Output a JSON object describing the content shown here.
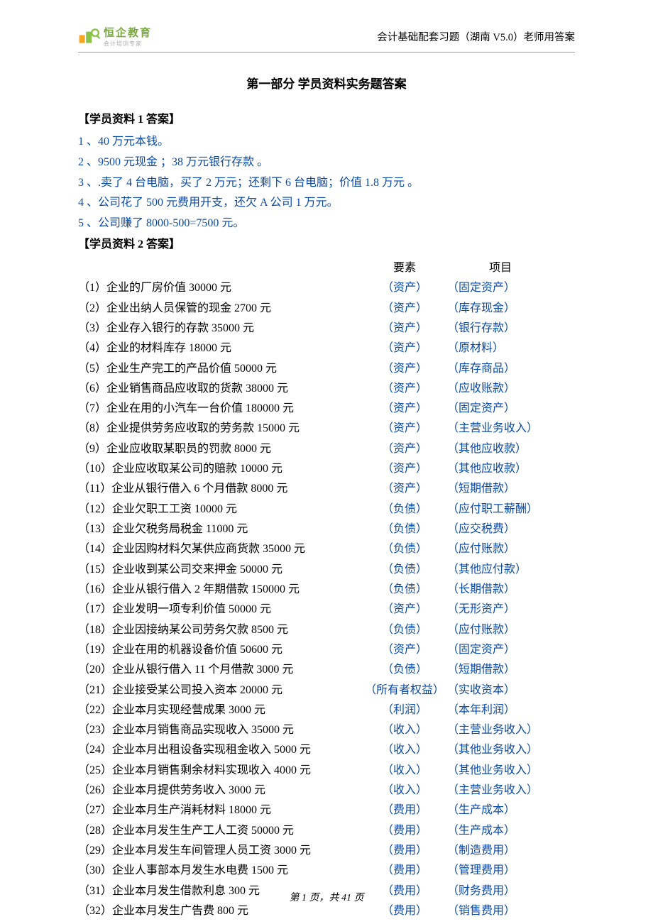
{
  "header": {
    "logo_main": "恒企教育",
    "logo_sub": "会计培训专家",
    "right": "会计基础配套习题（湖南 V5.0）老师用答案"
  },
  "title": "第一部分 学员资料实务题答案",
  "section1": {
    "head": "【学员资料 1 答案】",
    "lines": [
      "1 、40 万元本钱。",
      "2 、9500 元现金 ；38 万元银行存款 。",
      "3 、.卖了 4 台电脑，买了 2 万元；还剩下 6 台电脑；价值 1.8 万元 。",
      "4 、公司花了 500 元费用开支，还欠 A 公司 1 万元。",
      "5 、公司赚了 8000-500=7500 元。"
    ]
  },
  "section2": {
    "head": "【学员资料 2 答案】",
    "col_elem_head": "要素",
    "col_item_head": "项目",
    "rows": [
      {
        "desc": "（1）企业的厂房价值 30000 元",
        "elem": "（资产）",
        "item": "（固定资产）"
      },
      {
        "desc": "（2）企业出纳人员保管的现金 2700 元",
        "elem": "（资产）",
        "item": "（库存现金）"
      },
      {
        "desc": "（3）企业存入银行的存款 35000 元",
        "elem": "（资产）",
        "item": "（银行存款）"
      },
      {
        "desc": "（4）企业的材料库存 18000 元",
        "elem": "（资产）",
        "item": "（原材料）"
      },
      {
        "desc": "（5）企业生产完工的产品价值 50000 元",
        "elem": "（资产）",
        "item": "（库存商品）"
      },
      {
        "desc": "（6）企业销售商品应收取的货款 38000 元",
        "elem": "（资产）",
        "item": "（应收账款）"
      },
      {
        "desc": "（7）企业在用的小汽车一台价值 180000 元",
        "elem": "（资产）",
        "item": "（固定资产）"
      },
      {
        "desc": "（8）企业提供劳务应收取的劳务款 15000 元",
        "elem": "（资产）",
        "item": "（主营业务收入）"
      },
      {
        "desc": "（9）企业应收取某职员的罚款 8000 元",
        "elem": "（资产）",
        "item": "（其他应收款）"
      },
      {
        "desc": "（10）企业应收取某公司的赔款 10000 元",
        "elem": "（资产）",
        "item": "（其他应收款）"
      },
      {
        "desc": "（11）企业从银行借入 6 个月借款 8000 元",
        "elem": "（资产）",
        "item": "（短期借款）"
      },
      {
        "desc": "（12）企业欠职工工资 10000 元",
        "elem": "（负债）",
        "item": "（应付职工薪酬）"
      },
      {
        "desc": "（13）企业欠税务局税金 11000 元",
        "elem": "（负债）",
        "item": " （应交税费）"
      },
      {
        "desc": "（14）企业因购材料欠某供应商货款 35000 元",
        "elem": "（负债）",
        "item": " （应付账款）"
      },
      {
        "desc": "（15）企业收到某公司交来押金 50000 元",
        "elem": "（负债）",
        "item": " （其他应付款）"
      },
      {
        "desc": "（16）企业从银行借入 2 年期借款 150000 元",
        "elem": "（负债）",
        "item": " （长期借款）"
      },
      {
        "desc": "（17）企业发明一项专利价值 50000 元",
        "elem": "（资产）",
        "item": " （无形资产）"
      },
      {
        "desc": "（18）企业因接纳某公司劳务欠款 8500 元",
        "elem": "（负债）",
        "item": " （应付账款）"
      },
      {
        "desc": "（19）企业在用的机器设备价值 50600 元",
        "elem": "（资产）",
        "item": " （固定资产）"
      },
      {
        "desc": "（20）企业从银行借入 11 个月借款 3000 元",
        "elem": "（负债）",
        "item": " （短期借款）"
      },
      {
        "desc": "（21）企业接受某公司投入资本 20000 元",
        "elem": "（所有者权益）",
        "item": " （实收资本）"
      },
      {
        "desc": "（22）企业本月实现经营成果 3000 元",
        "elem": "（利润）",
        "item": " （本年利润）"
      },
      {
        "desc": "（23）企业本月销售商品实现收入 35000 元",
        "elem": "（收入）",
        "item": " （主营业务收入）"
      },
      {
        "desc": "（24）企业本月出租设备实现租金收入 5000 元",
        "elem": "（收入）",
        "item": " （其他业务收入）"
      },
      {
        "desc": "（25）企业本月销售剩余材料实现收入 4000 元",
        "elem": "（收入）",
        "item": " （其他业务收入）"
      },
      {
        "desc": "（26）企业本月提供劳务收入 3000 元",
        "elem": "（收入）",
        "item": " （主营业务收入）"
      },
      {
        "desc": "（27）企业本月生产消耗材料 18000 元",
        "elem": "（费用）",
        "item": " （生产成本）"
      },
      {
        "desc": "（28）企业本月发生生产工人工资 50000 元",
        "elem": "（费用）",
        "item": " （生产成本）"
      },
      {
        "desc": "（29）企业本月发生车间管理人员工资 3000 元",
        "elem": "（费用）",
        "item": " （制造费用）"
      },
      {
        "desc": "（30）企业人事部本月发生水电费 1500 元",
        "elem": "（费用）",
        "item": " （管理费用）"
      },
      {
        "desc": "（31）企业本月发生借款利息 300 元",
        "elem": "（费用）",
        "item": " （财务费用）"
      },
      {
        "desc": "（32）企业本月发生广告费 800 元",
        "elem": "（费用）",
        "item": " （销售费用）"
      }
    ]
  },
  "footer": "第 1 页，共 41 页"
}
